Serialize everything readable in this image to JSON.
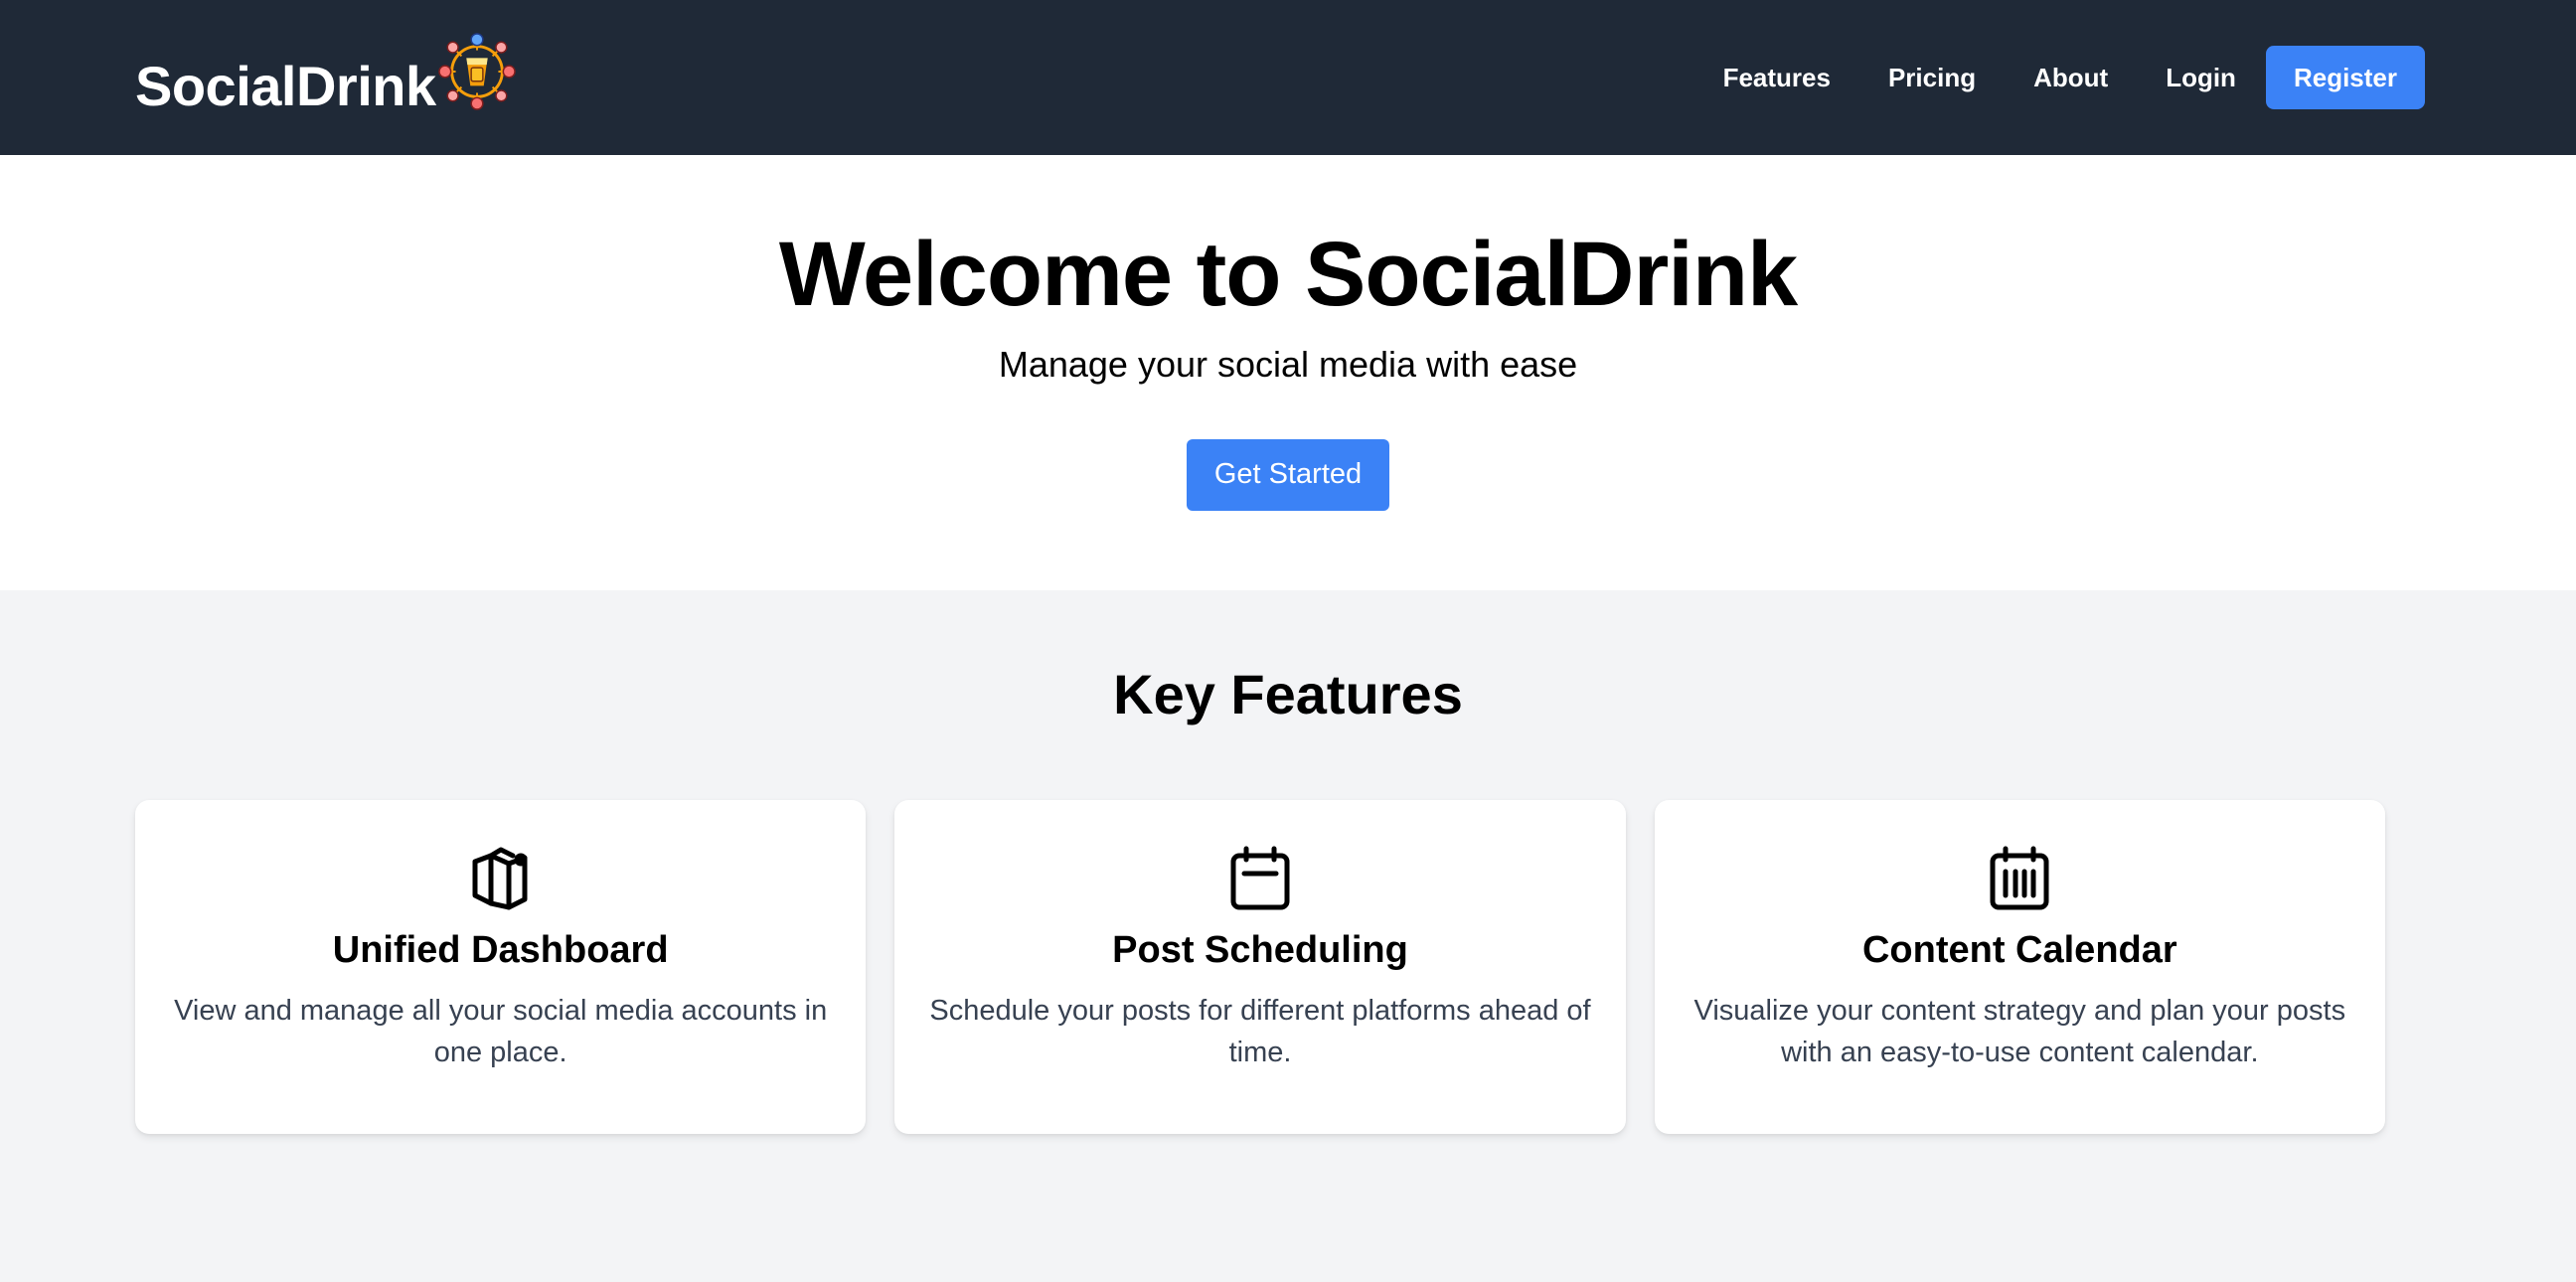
{
  "nav": {
    "brand": "SocialDrink",
    "links": [
      {
        "label": "Features"
      },
      {
        "label": "Pricing"
      },
      {
        "label": "About"
      },
      {
        "label": "Login"
      }
    ],
    "register_label": "Register"
  },
  "hero": {
    "title": "Welcome to SocialDrink",
    "subtitle": "Manage your social media with ease",
    "cta_label": "Get Started"
  },
  "features": {
    "title": "Key Features",
    "cards": [
      {
        "icon": "dashboard-icon",
        "title": "Unified Dashboard",
        "text": "View and manage all your social media accounts in one place."
      },
      {
        "icon": "calendar-icon",
        "title": "Post Scheduling",
        "text": "Schedule your posts for different platforms ahead of time."
      },
      {
        "icon": "calendar-grid-icon",
        "title": "Content Calendar",
        "text": "Visualize your content strategy and plan your posts with an easy-to-use content calendar."
      }
    ]
  },
  "colors": {
    "navbar": "#1f2937",
    "accent": "#3b82f6",
    "page_bg": "#f3f4f6"
  }
}
